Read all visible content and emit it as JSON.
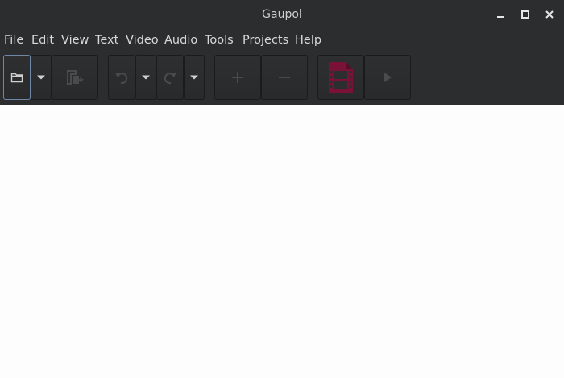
{
  "window": {
    "title": "Gaupol"
  },
  "menubar": {
    "items": [
      {
        "label": "File"
      },
      {
        "label": "Edit"
      },
      {
        "label": "View"
      },
      {
        "label": "Text"
      },
      {
        "label": "Video"
      },
      {
        "label": "Audio"
      },
      {
        "label": "Tools"
      },
      {
        "label": "Projects"
      },
      {
        "label": "Help"
      }
    ]
  },
  "toolbar": {
    "buttons": [
      {
        "icon": "open-folder-icon",
        "enabled": true,
        "focused": true
      },
      {
        "icon": "open-dropdown-arrow-icon",
        "enabled": true
      },
      {
        "icon": "save-icon",
        "enabled": false
      },
      {
        "icon": "undo-icon",
        "enabled": false
      },
      {
        "icon": "undo-dropdown-arrow-icon",
        "enabled": true
      },
      {
        "icon": "redo-icon",
        "enabled": false
      },
      {
        "icon": "redo-dropdown-arrow-icon",
        "enabled": true
      },
      {
        "icon": "insert-icon",
        "enabled": false
      },
      {
        "icon": "remove-icon",
        "enabled": false
      },
      {
        "icon": "video-file-icon",
        "enabled": true
      },
      {
        "icon": "preview-play-icon",
        "enabled": false
      }
    ]
  },
  "colors": {
    "chrome_bg": "#2c2d2f",
    "text": "#d8d8d8",
    "disabled_icon": "#4a4b4d",
    "video_icon": "#7a1238",
    "content_bg": "#fdfdfd"
  }
}
